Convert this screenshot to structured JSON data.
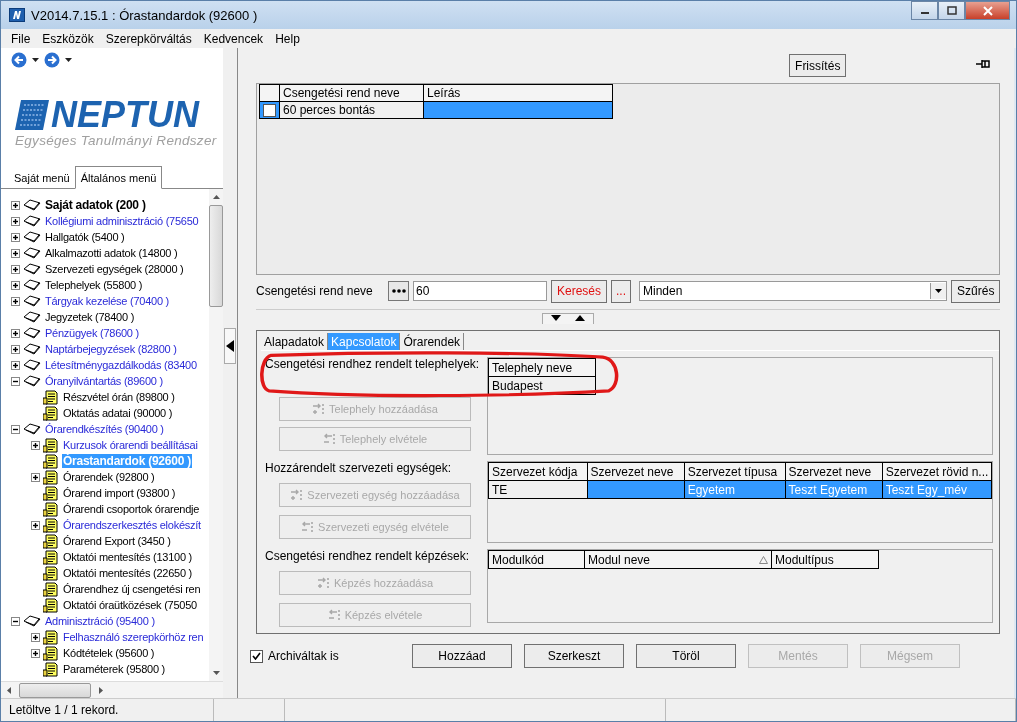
{
  "window": {
    "title": "V2014.7.15.1 : Órastandardok (92600  )"
  },
  "menu": [
    "File",
    "Eszközök",
    "Szerepkörváltás",
    "Kedvencek",
    "Help"
  ],
  "sidebar": {
    "logo": {
      "name": "NEPTUN",
      "subtitle": "Egységes Tanulmányi Rendszer"
    },
    "tabs": [
      {
        "label": "Saját menü",
        "selected": false
      },
      {
        "label": "Általános menü",
        "selected": true
      }
    ],
    "tree": [
      {
        "label": "Saját adatok (200  )",
        "kind": "bold",
        "expanded": false,
        "selected": false
      },
      {
        "label": "Kollégiumi adminisztráció (75650",
        "kind": "link",
        "expanded": false,
        "selected": false
      },
      {
        "label": "Hallgatók (5400  )",
        "kind": "plain",
        "expanded": false,
        "selected": false
      },
      {
        "label": "Alkalmazotti adatok (14800  )",
        "kind": "plain",
        "expanded": false,
        "selected": false
      },
      {
        "label": "Szervezeti egységek (28000  )",
        "kind": "plain",
        "expanded": false,
        "selected": false
      },
      {
        "label": "Telephelyek (55800  )",
        "kind": "plain",
        "expanded": false,
        "selected": false
      },
      {
        "label": "Tárgyak kezelése (70400  )",
        "kind": "link",
        "expanded": false,
        "selected": false
      },
      {
        "label": "Jegyzetek (78400  )",
        "kind": "plain",
        "selected": false
      },
      {
        "label": "Pénzügyek (78600  )",
        "kind": "link",
        "expanded": false,
        "selected": false
      },
      {
        "label": "Naptárbejegyzések (82800  )",
        "kind": "link",
        "expanded": false,
        "selected": false
      },
      {
        "label": "Létesítménygazdálkodás (83400",
        "kind": "link",
        "expanded": false,
        "selected": false
      },
      {
        "label": "Óranyilvántartás (89600  )",
        "kind": "link",
        "expanded": true,
        "selected": false,
        "children": [
          {
            "label": "Részvétel órán (89800  )",
            "kind": "plain",
            "selected": false
          },
          {
            "label": "Oktatás adatai (90000  )",
            "kind": "plain",
            "selected": false
          }
        ]
      },
      {
        "label": "Órarendkészítés (90400  )",
        "kind": "link",
        "expanded": true,
        "selected": false,
        "children": [
          {
            "label": "Kurzusok órarendi beállításai",
            "kind": "link",
            "expanded": false,
            "selected": false
          },
          {
            "label": "Órastandardok (92600  )",
            "kind": "bold",
            "selected": true
          },
          {
            "label": "Órarendek (92800  )",
            "kind": "plain",
            "expanded": false,
            "selected": false
          },
          {
            "label": "Órarend import (93800  )",
            "kind": "plain",
            "selected": false
          },
          {
            "label": "Órarendi csoportok órarendje",
            "kind": "plain",
            "selected": false
          },
          {
            "label": "Órarendszerkesztés elokészít",
            "kind": "link",
            "expanded": false,
            "selected": false
          },
          {
            "label": "Órarend Export (3450  )",
            "kind": "plain",
            "selected": false
          },
          {
            "label": "Oktatói mentesítés (13100  )",
            "kind": "plain",
            "selected": false
          },
          {
            "label": "Oktatói mentesítés (22650  )",
            "kind": "plain",
            "selected": false
          },
          {
            "label": "Órarendhez új csengetési ren",
            "kind": "plain",
            "selected": false
          },
          {
            "label": "Oktatói óraütközések (75050",
            "kind": "plain",
            "selected": false
          }
        ]
      },
      {
        "label": "Adminisztráció (95400  )",
        "kind": "link",
        "expanded": true,
        "selected": false,
        "children": [
          {
            "label": "Felhasználó szerepkörhöz ren",
            "kind": "link",
            "expanded": false,
            "selected": false
          },
          {
            "label": "Kódtételek (95600  )",
            "kind": "plain",
            "expanded": false,
            "selected": false
          },
          {
            "label": "Paraméterek (95800  )",
            "kind": "plain",
            "selected": false
          }
        ]
      }
    ]
  },
  "toolbar": {
    "refresh_button": "Frissítés"
  },
  "grid": {
    "columns": [
      "Csengetési rend neve",
      "Leírás"
    ],
    "rows": [
      {
        "checked": false,
        "selected": true,
        "cells": [
          "60 perces bontás",
          null
        ]
      }
    ]
  },
  "filter": {
    "label": "Csengetési rend neve",
    "value": "60",
    "search_button": "Keresés",
    "more_button": "...",
    "dropdown_value": "Minden",
    "filter_button": "Szűrés"
  },
  "detail_tabs": [
    {
      "label": "Alapadatok",
      "selected": false
    },
    {
      "label": "Kapcsolatok",
      "selected": true
    },
    {
      "label": "Órarendek",
      "selected": false
    }
  ],
  "sections": [
    {
      "label": "Csengetési rendhez rendelt telephelyek:",
      "buttons": [
        {
          "label": "Telephely hozzáadása",
          "kind": "add",
          "disabled": true
        },
        {
          "label": "Telephely elvétele",
          "kind": "remove",
          "disabled": true
        }
      ],
      "table": {
        "columns": [
          {
            "label": "Telephely neve",
            "sorted": false
          }
        ],
        "rows": [
          {
            "selected": false,
            "cells": [
              "Budapest"
            ]
          }
        ]
      }
    },
    {
      "label": "Hozzárendelt szervezeti egységek:",
      "buttons": [
        {
          "label": "Szervezeti egység hozzáadása",
          "kind": "add",
          "disabled": true
        },
        {
          "label": "Szervezeti egység elvétele",
          "kind": "remove",
          "disabled": true
        }
      ],
      "table": {
        "columns": [
          {
            "label": "Szervezet kódja",
            "sorted": false
          },
          {
            "label": "Szervezet neve",
            "sorted": false
          },
          {
            "label": "Szervezet típusa",
            "sorted": false
          },
          {
            "label": "Szervezet neve",
            "sorted": false
          },
          {
            "label": "Szervezet rövid n...",
            "sorted": false
          }
        ],
        "rows": [
          {
            "selected": true,
            "cells": [
              "TE",
              null,
              "Egyetem",
              "Teszt Egyetem",
              "Teszt Egy_mév"
            ]
          }
        ]
      }
    },
    {
      "label": "Csengetési rendhez rendelt képzések:",
      "buttons": [
        {
          "label": "Képzés hozzáadása",
          "kind": "add",
          "disabled": true
        },
        {
          "label": "Képzés elvétele",
          "kind": "remove",
          "disabled": true
        }
      ],
      "table": {
        "columns": [
          {
            "label": "Modulkód",
            "sorted": false
          },
          {
            "label": "Modul neve",
            "sorted": true
          },
          {
            "label": "Modultípus",
            "sorted": false
          }
        ]
      }
    }
  ],
  "archived_checkbox": {
    "label": "Archiváltak is",
    "checked": true
  },
  "action_buttons": [
    {
      "label": "Hozzáad",
      "disabled": false
    },
    {
      "label": "Szerkeszt",
      "disabled": false
    },
    {
      "label": "Töröl",
      "disabled": false
    },
    {
      "label": "Mentés",
      "disabled": true
    },
    {
      "label": "Mégsem",
      "disabled": true
    }
  ],
  "status_bar": {
    "text": "Letöltve 1 / 1 rekord."
  }
}
